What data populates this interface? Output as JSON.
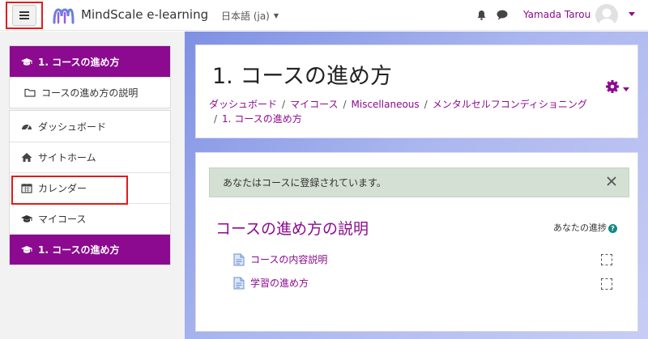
{
  "navbar": {
    "menu_icon": "hamburger-icon",
    "brand": "MindScale e-learning",
    "language": "日本語 (ja)",
    "notification_icon": "bell-icon",
    "messages_icon": "chat-icon",
    "user_name": "Yamada Tarou"
  },
  "drawer": {
    "course_group": [
      {
        "label": "1. コースの進め方",
        "icon": "graduation-cap-icon",
        "active": true
      },
      {
        "label": "コースの進め方の説明",
        "icon": "folder-icon",
        "active": false
      }
    ],
    "site_group": [
      {
        "label": "ダッシュボード",
        "icon": "dashboard-icon"
      },
      {
        "label": "サイトホーム",
        "icon": "home-icon"
      },
      {
        "label": "カレンダー",
        "icon": "calendar-icon"
      },
      {
        "label": "マイコース",
        "icon": "graduation-cap-icon"
      },
      {
        "label": "1. コースの進め方",
        "icon": "graduation-cap-icon",
        "active": true
      }
    ]
  },
  "header": {
    "title": "1. コースの進め方",
    "settings_icon": "gear-icon",
    "breadcrumb": [
      "ダッシュボード",
      "マイコース",
      "Miscellaneous",
      "メンタルセルフコンディショニング",
      "1. コースの進め方"
    ]
  },
  "content": {
    "alert": "あなたはコースに登録されています。",
    "section_title": "コースの進め方の説明",
    "progress_label": "あなたの進捗",
    "activities": [
      {
        "label": "コースの内容説明",
        "icon": "page-icon"
      },
      {
        "label": "学習の進め方",
        "icon": "page-icon"
      }
    ]
  },
  "colors": {
    "accent": "#8b0a8f",
    "alert_bg": "#d4e0d4",
    "highlight": "#e31b1b"
  }
}
